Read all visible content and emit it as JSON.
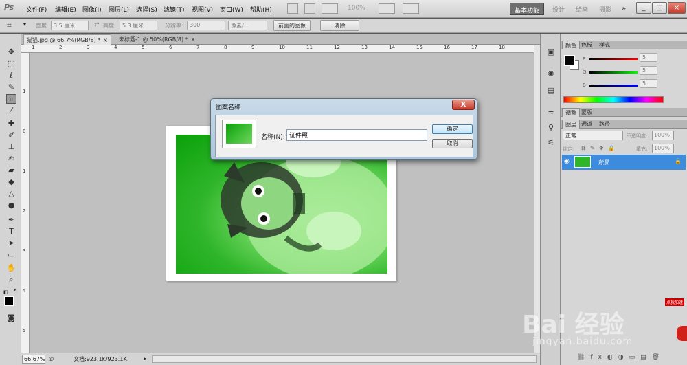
{
  "menubar": {
    "logo": "Ps",
    "items": [
      "文件(F)",
      "编辑(E)",
      "图像(I)",
      "图层(L)",
      "选择(S)",
      "滤镜(T)",
      "视图(V)",
      "窗口(W)",
      "帮助(H)"
    ],
    "zoom": "100%",
    "workspaces": [
      "基本功能",
      "设计",
      "绘画",
      "摄影"
    ],
    "more": "»"
  },
  "optbar": {
    "width_label": "宽度:",
    "width_value": "3.5 厘米",
    "height_label": "高度:",
    "height_value": "5.3 厘米",
    "resolution_label": "分辨率:",
    "resolution_value": "300",
    "unit_value": "像素/...",
    "front_image_btn": "前面的图像",
    "clear_btn": "清除"
  },
  "tabs": [
    {
      "label": "猫猫.jpg @ 66.7%(RGB/8) *",
      "active": true
    },
    {
      "label": "未标题-1 @ 50%(RGB/8) *",
      "active": false
    }
  ],
  "ruler_top": [
    "1",
    "2",
    "3",
    "4",
    "5",
    "6",
    "7",
    "8",
    "9",
    "10",
    "11",
    "12",
    "13",
    "14",
    "15",
    "16",
    "17",
    "18"
  ],
  "ruler_left": [
    "1",
    "0",
    "1",
    "2",
    "3",
    "4",
    "5"
  ],
  "status": {
    "zoom": "66.67%",
    "doc": "文档:923.1K/923.1K"
  },
  "color_panel": {
    "tabs": [
      "颜色",
      "色板",
      "样式"
    ],
    "r_label": "R",
    "g_label": "G",
    "b_label": "B",
    "r": "5",
    "g": "5",
    "b": "5",
    "fg_color": "#050505"
  },
  "adjust_panel": {
    "tabs": [
      "调整",
      "蒙版"
    ]
  },
  "layers_panel": {
    "tabs": [
      "图层",
      "通道",
      "路径"
    ],
    "blend_mode": "正常",
    "opacity_label": "不透明度:",
    "opacity": "100%",
    "lock_label": "锁定:",
    "fill_label": "填充:",
    "fill": "100%",
    "layer_name": "背景"
  },
  "dialog": {
    "title": "图案名称",
    "name_label": "名称(N):",
    "name_value": "证件照",
    "ok": "确定",
    "cancel": "取消",
    "close": "X"
  },
  "watermark": {
    "brand": "Bai 经验",
    "url": "jingyan.baidu.com",
    "badge": "点我加速"
  },
  "colors": {
    "selection": "#3d8bdc",
    "photo_green": "#0aa10a",
    "canvas_bg": "#c0c0c0"
  }
}
